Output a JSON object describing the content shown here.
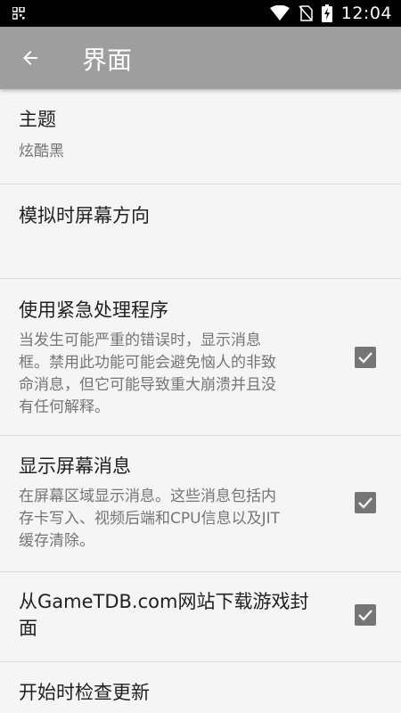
{
  "status_bar": {
    "time": "12:04",
    "icons": [
      "notification-grid-icon",
      "wifi-icon",
      "no-sim-icon",
      "battery-charging-icon"
    ]
  },
  "app_bar": {
    "back_icon": "arrow-left-icon",
    "title": "界面"
  },
  "settings": [
    {
      "title": "主题",
      "summary": "炫酷黑"
    },
    {
      "title": "模拟时屏幕方向",
      "summary": ""
    },
    {
      "title": "使用紧急处理程序",
      "summary_lines": [
        "当发生可能严重的错误时，显示消息",
        "框。禁用此功能可能会避免恼人的非致",
        "命消息，但它可能导致重大崩溃并且没",
        "有任何解释。"
      ],
      "checked": true
    },
    {
      "title": "显示屏幕消息",
      "summary_lines": [
        "在屏幕区域显示消息。这些消息包括内",
        "存卡写入、视频后端和CPU信息以及JIT",
        "缓存清除。"
      ],
      "checked": true
    },
    {
      "title_lines": [
        "从GameTDB.com网站下载游戏封",
        "面"
      ],
      "checked": true
    },
    {
      "title": "开始时检查更新"
    }
  ],
  "colors": {
    "app_bar": "#9e9e9e",
    "status_bar": "#000000",
    "background": "#f5f5f5",
    "checkbox": "#757575"
  }
}
